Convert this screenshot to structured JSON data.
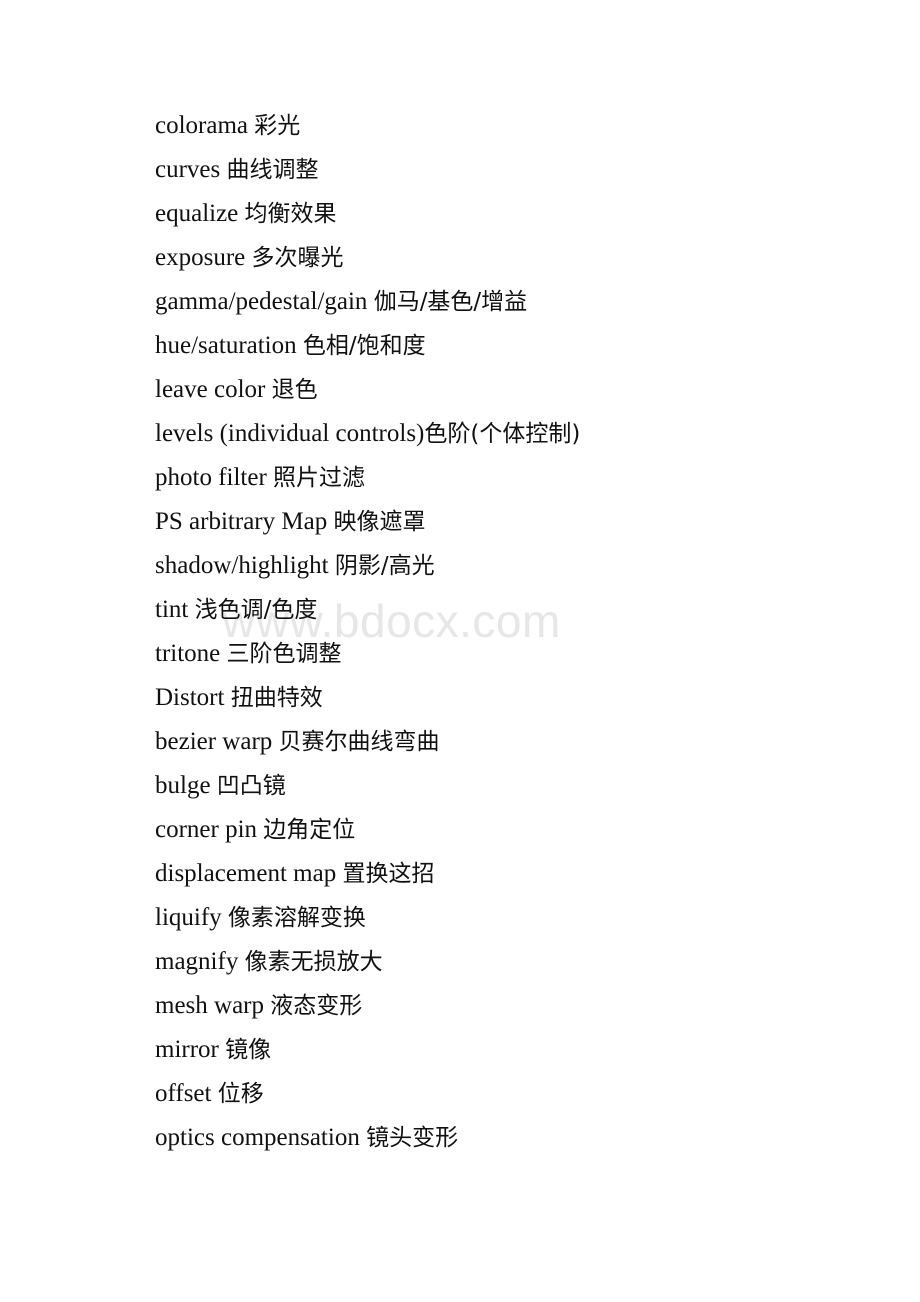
{
  "document": {
    "page_background": "#ffffff",
    "text_color": "#111111",
    "watermark": {
      "text": "www.bdocx.com",
      "color": "#e7e7e7"
    },
    "lines": [
      {
        "term": "colorama",
        "translation": "彩光",
        "separator": " "
      },
      {
        "term": "curves",
        "translation": "曲线调整",
        "separator": " "
      },
      {
        "term": "equalize",
        "translation": "均衡效果",
        "separator": " "
      },
      {
        "term": "exposure",
        "translation": "多次曝光",
        "separator": " "
      },
      {
        "term": "gamma/pedestal/gain",
        "translation": "伽马/基色/增益",
        "separator": " "
      },
      {
        "term": "hue/saturation",
        "translation": "色相/饱和度",
        "separator": " "
      },
      {
        "term": "leave color",
        "translation": "退色",
        "separator": " "
      },
      {
        "term": "levels (individual controls)",
        "translation": "色阶(个体控制)",
        "separator": ""
      },
      {
        "term": "photo filter",
        "translation": "照片过滤",
        "separator": " "
      },
      {
        "term": "PS arbitrary Map",
        "translation": "映像遮罩",
        "separator": " "
      },
      {
        "term": "shadow/highlight",
        "translation": "阴影/高光",
        "separator": " "
      },
      {
        "term": "tint",
        "translation": "浅色调/色度",
        "separator": " "
      },
      {
        "term": "tritone",
        "translation": "三阶色调整",
        "separator": " "
      },
      {
        "term": "Distort",
        "translation": "扭曲特效",
        "separator": " "
      },
      {
        "term": "bezier warp",
        "translation": "贝赛尔曲线弯曲",
        "separator": " "
      },
      {
        "term": "bulge",
        "translation": "凹凸镜",
        "separator": " "
      },
      {
        "term": "corner pin",
        "translation": "边角定位",
        "separator": " "
      },
      {
        "term": "displacement map",
        "translation": "置换这招",
        "separator": " "
      },
      {
        "term": "liquify",
        "translation": "像素溶解变换",
        "separator": " "
      },
      {
        "term": "magnify",
        "translation": "像素无损放大",
        "separator": " "
      },
      {
        "term": "mesh warp",
        "translation": "液态变形",
        "separator": " "
      },
      {
        "term": "mirror",
        "translation": "镜像",
        "separator": " "
      },
      {
        "term": "offset",
        "translation": "位移",
        "separator": " "
      },
      {
        "term": "optics compensation",
        "translation": "镜头变形",
        "separator": " "
      }
    ]
  }
}
